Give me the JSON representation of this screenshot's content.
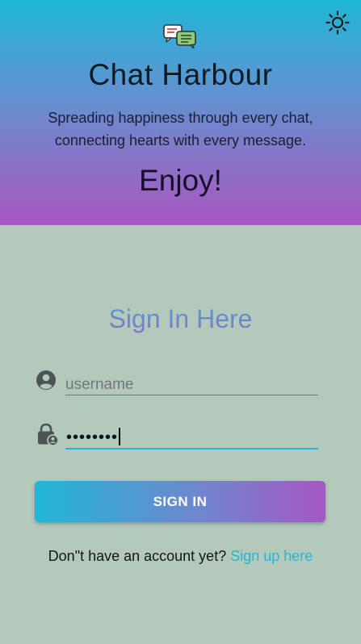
{
  "header": {
    "app_title": "Chat Harbour",
    "tagline": "Spreading happiness through every chat, connecting hearts with every message.",
    "enjoy_text": "Enjoy!",
    "logo_icon": "chat-bubbles-icon",
    "theme_toggle_icon": "sun-icon"
  },
  "form": {
    "title": "Sign In Here",
    "username": {
      "icon": "account-circle-icon",
      "placeholder": "username",
      "value": ""
    },
    "password": {
      "icon": "lock-person-icon",
      "value_display": "••••••••"
    },
    "signin_label": "SIGN IN",
    "signup_prompt": "Don\"t have an account yet?",
    "signup_link": "Sign up here"
  },
  "colors": {
    "gradient_start": "#1fb6d6",
    "gradient_end": "#a657c3",
    "background": "#b3c9bc",
    "link": "#27b2d6"
  }
}
